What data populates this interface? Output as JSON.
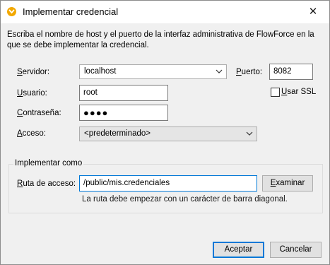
{
  "window": {
    "title": "Implementar credencial",
    "close_glyph": "✕"
  },
  "intro_text": "Escriba el nombre de host y el puerto de la interfaz administrativa de FlowForce en la que se debe implementar la credencial.",
  "server": {
    "label_accel": "S",
    "label_rest": "ervidor:",
    "value": "localhost"
  },
  "port": {
    "label_accel": "P",
    "label_rest": "uerto:",
    "value": "8082"
  },
  "user": {
    "label_accel": "U",
    "label_rest": "suario:",
    "value": "root"
  },
  "ssl": {
    "label_accel": "U",
    "label_rest": "sar SSL",
    "checked": false
  },
  "password": {
    "label_accel": "C",
    "label_rest": "ontraseña:",
    "value": "●●●●"
  },
  "access": {
    "label_accel": "A",
    "label_rest": "cceso:",
    "value": "<predeterminado>"
  },
  "deploy_group": {
    "title": "Implementar como",
    "path_label_accel": "R",
    "path_label_rest": "uta de acceso:",
    "path_value": "/public/mis.credenciales",
    "browse_label_accel": "E",
    "browse_label_rest": "xaminar",
    "hint": "La ruta debe empezar con un carácter de barra diagonal."
  },
  "footer": {
    "accept_label": "Aceptar",
    "cancel_label": "Cancelar"
  },
  "colors": {
    "accent": "#0078d7",
    "icon": "#f2a800"
  },
  "icons": {
    "app": "altova-app-icon",
    "close": "close-icon",
    "dropdown": "chevron-down-icon"
  }
}
